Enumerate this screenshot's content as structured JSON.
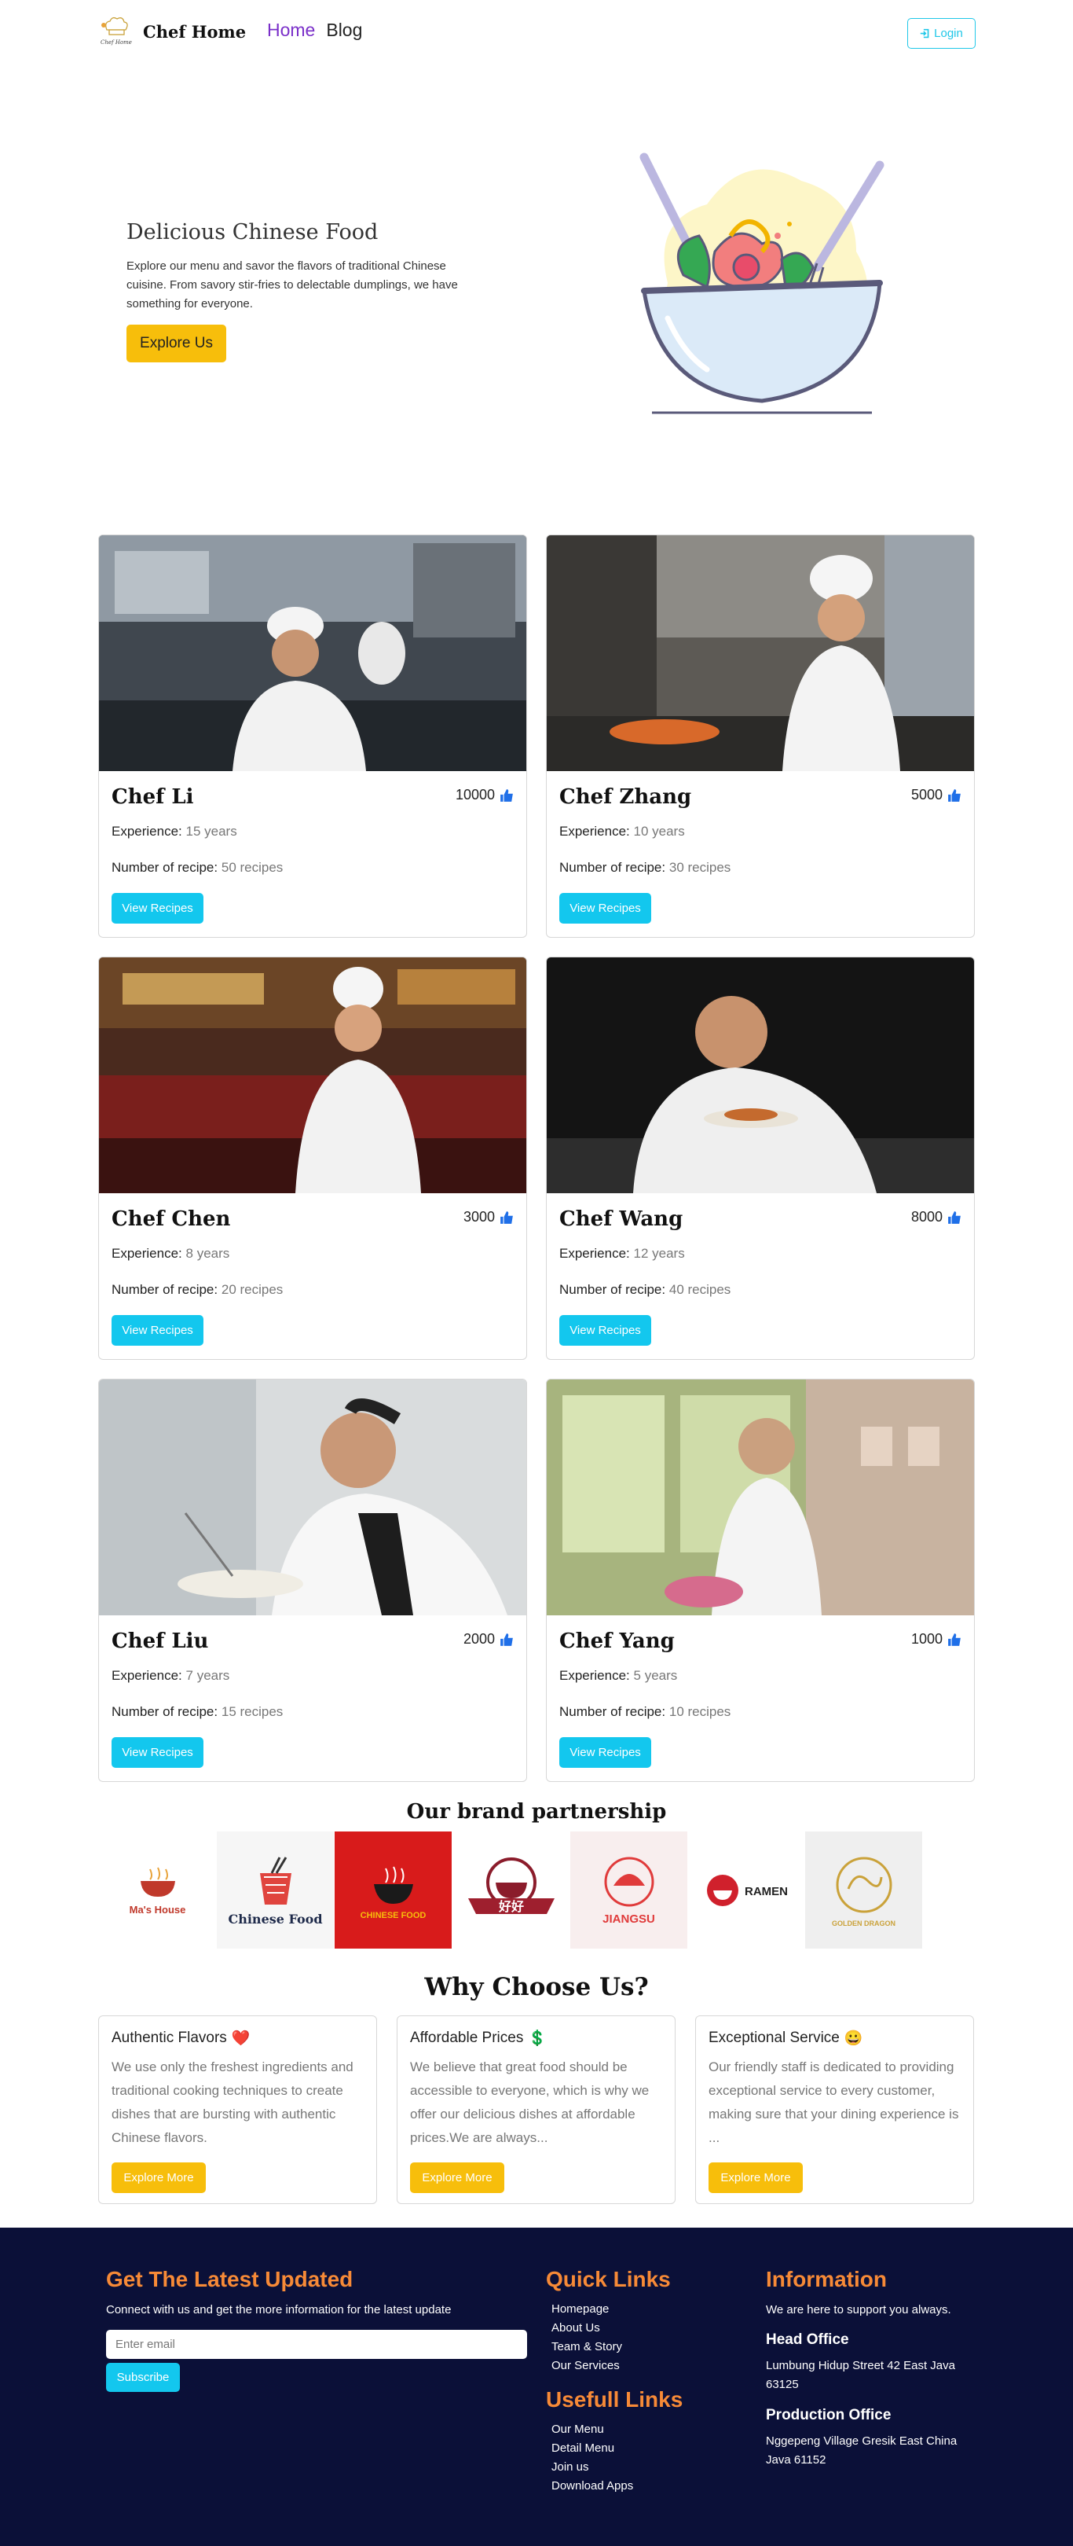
{
  "nav": {
    "brand": "Chef Home",
    "logo_text": "Chef Home",
    "links": [
      "Home",
      "Blog"
    ],
    "login_label": "Login"
  },
  "hero": {
    "title": "Delicious Chinese Food",
    "text": "Explore our menu and savor the flavors of traditional Chinese cuisine. From savory stir-fries to delectable dumplings, we have something for everyone.",
    "button": "Explore Us"
  },
  "chefs": [
    {
      "name": "Chef Li",
      "likes": "10000",
      "exp_label": "Experience:",
      "exp": "15 years",
      "rec_label": "Number of recipe:",
      "rec": "50 recipes",
      "button": "View Recipes"
    },
    {
      "name": "Chef Zhang",
      "likes": "5000",
      "exp_label": "Experience:",
      "exp": "10 years",
      "rec_label": "Number of recipe:",
      "rec": "30 recipes",
      "button": "View Recipes"
    },
    {
      "name": "Chef Chen",
      "likes": "3000",
      "exp_label": "Experience:",
      "exp": "8 years",
      "rec_label": "Number of recipe:",
      "rec": "20 recipes",
      "button": "View Recipes"
    },
    {
      "name": "Chef Wang",
      "likes": "8000",
      "exp_label": "Experience:",
      "exp": "12 years",
      "rec_label": "Number of recipe:",
      "rec": "40 recipes",
      "button": "View Recipes"
    },
    {
      "name": "Chef Liu",
      "likes": "2000",
      "exp_label": "Experience:",
      "exp": "7 years",
      "rec_label": "Number of recipe:",
      "rec": "15 recipes",
      "button": "View Recipes"
    },
    {
      "name": "Chef Yang",
      "likes": "1000",
      "exp_label": "Experience:",
      "exp": "5 years",
      "rec_label": "Number of recipe:",
      "rec": "10 recipes",
      "button": "View Recipes"
    }
  ],
  "brands": {
    "title": "Our brand partnership",
    "logos": [
      "Ma's House",
      "Chinese Food",
      "CHINESE FOOD",
      "好好",
      "JIANGSU",
      "RAMEN",
      "GOLDEN DRAGON"
    ]
  },
  "why": {
    "title": "Why Choose Us?",
    "cards": [
      {
        "title": "Authentic Flavors",
        "emoji": "❤️",
        "text": "We use only the freshest ingredients and traditional cooking techniques to create dishes that are bursting with authentic Chinese flavors.",
        "button": "Explore More"
      },
      {
        "title": "Affordable Prices",
        "emoji": "💲",
        "text": "We believe that great food should be accessible to everyone, which is why we offer our delicious dishes at affordable prices.We are always...",
        "button": "Explore More"
      },
      {
        "title": "Exceptional Service",
        "emoji": "😀",
        "text": "Our friendly staff is dedicated to providing exceptional service to every customer, making sure that your dining experience is ...",
        "button": "Explore More"
      }
    ]
  },
  "footer": {
    "newsletter_title": "Get The Latest Updated",
    "newsletter_text": "Connect with us and get the more information for the latest update",
    "email_placeholder": "Enter email",
    "subscribe": "Subscribe",
    "quick_title": "Quick Links",
    "quick_links": [
      "Homepage",
      "About Us",
      "Team & Story",
      "Our Services"
    ],
    "useful_title": "Usefull Links",
    "useful_links": [
      "Our Menu",
      "Detail Menu",
      "Join us",
      "Download Apps"
    ],
    "info_title": "Information",
    "info_text": "We are here to support you always.",
    "head_office_title": "Head Office",
    "head_office": "Lumbung Hidup Street 42 East Java 63125",
    "prod_office_title": "Production Office",
    "prod_office": "Nggepeng Village Gresik East China Java 61152"
  },
  "colors": {
    "accent_yellow": "#f7be0b",
    "accent_cyan": "#13c7ee",
    "nav_active": "#7a2fc9",
    "footer_bg": "#0b1038",
    "footer_heading": "#f78a37"
  }
}
